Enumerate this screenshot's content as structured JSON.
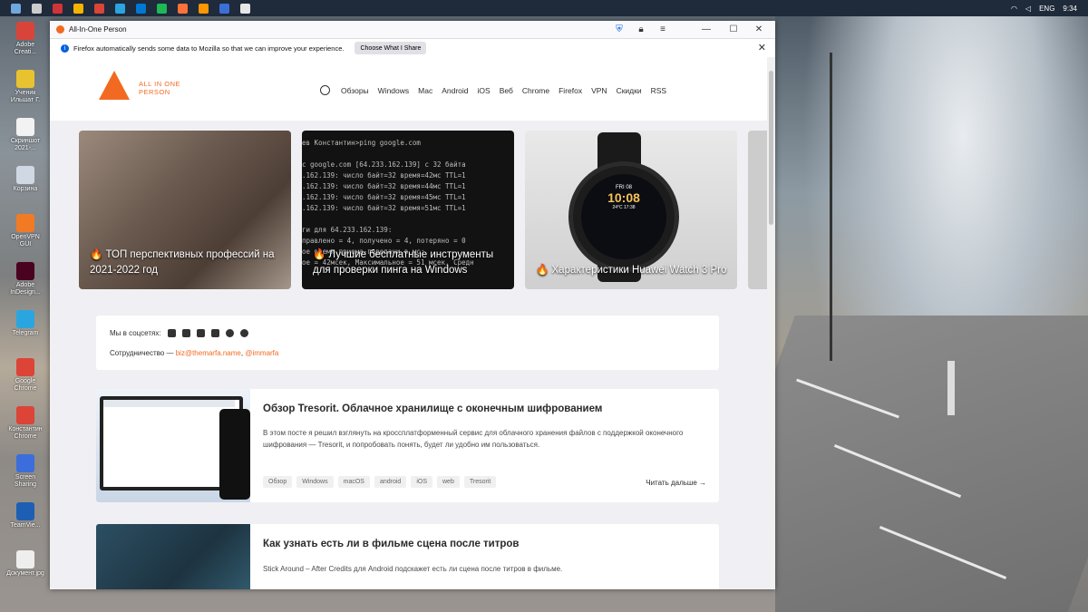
{
  "taskbar": {
    "icons": [
      {
        "name": "windows-start-icon",
        "color": "#6fa8dc"
      },
      {
        "name": "search-icon",
        "color": "#cccccc"
      },
      {
        "name": "app-red-icon",
        "color": "#d13438"
      },
      {
        "name": "chrome-icon",
        "color": "#f4b400"
      },
      {
        "name": "chrome-icon",
        "color": "#db4437"
      },
      {
        "name": "telegram-icon",
        "color": "#2aa5e0"
      },
      {
        "name": "outlook-icon",
        "color": "#0078d4"
      },
      {
        "name": "spotify-icon",
        "color": "#1db954"
      },
      {
        "name": "firefox-icon",
        "color": "#ff7139"
      },
      {
        "name": "firefox-icon",
        "color": "#ff9500"
      },
      {
        "name": "app-blue-icon",
        "color": "#3a6fd8"
      },
      {
        "name": "app-white-icon",
        "color": "#e6e6e6"
      }
    ],
    "tray": {
      "lang": "ENG",
      "time": "9:34"
    }
  },
  "desktop_icons": [
    {
      "label": "Adobe Creati...",
      "color": "#d9443a"
    },
    {
      "label": "Ученик Ильшат Г.",
      "color": "#e8c32f"
    },
    {
      "label": "Скриншот 2021-...",
      "color": "#f2f2f2"
    },
    {
      "label": "Корзина",
      "color": "#cfd8e3"
    },
    {
      "label": "OpenVPN GUI",
      "color": "#f17b24"
    },
    {
      "label": "Adobe InDesign...",
      "color": "#49021f"
    },
    {
      "label": "Telegram",
      "color": "#2aa5e0"
    },
    {
      "label": "Google Chrome",
      "color": "#db4437"
    },
    {
      "label": "Константин Chrome",
      "color": "#db4437"
    },
    {
      "label": "Screen Sharing",
      "color": "#3c6edb"
    },
    {
      "label": "TeamVie...",
      "color": "#1e5fb4"
    },
    {
      "label": "Документ.jpg",
      "color": "#eeeeee"
    }
  ],
  "window": {
    "title": "All-In-One Person",
    "notification": "Firefox automatically sends some data to Mozilla so that we can improve your experience.",
    "notification_button": "Choose What I Share"
  },
  "site": {
    "logo_text": "ALL IN ONE PERSON",
    "nav": [
      "Обзоры",
      "Windows",
      "Mac",
      "Android",
      "iOS",
      "Веб",
      "Chrome",
      "Firefox",
      "VPN",
      "Скидки",
      "RSS"
    ],
    "carousel": [
      {
        "title": "🔥 ТОП перспективных профессий на 2021-2022 год"
      },
      {
        "title": "🔥 Лучшие бесплатные инструменты для проверки пинга на Windows"
      },
      {
        "title": "🔥 Характеристики Huawei Watch 3 Pro"
      }
    ],
    "terminal_lines": [
      "ев Константин>ping google.com",
      "",
      "с google.com [64.233.162.139] с 32 байта",
      ".162.139: число байт=32 время=42мс TTL=1",
      ".162.139: число байт=32 время=44мс TTL=1",
      ".162.139: число байт=32 время=45мс TTL=1",
      ".162.139: число байт=32 время=51мс TTL=1",
      "",
      "ги для 64.233.162.139:",
      "правлено = 4, получено = 4, потеряно = 0",
      "ое время приема-передачи в мс:",
      "ое = 42мсек, Максимальное = 51 мсек, Средн"
    ],
    "watch": {
      "date": "FRI 08",
      "time": "10:08",
      "temp": "24°C 17:38"
    },
    "social_label": "Мы в соцсетях:",
    "coop_label": "Сотрудничество —",
    "coop_email": "biz@themarfa.name",
    "coop_sep": ",",
    "coop_handle": "@immarfa",
    "posts": [
      {
        "title": "Обзор Tresorit. Облачное хранилище с оконечным шифрованием",
        "excerpt": "В этом посте я решил взглянуть на кроссплатформенный сервис для облачного хранения файлов с поддержкой оконечного шифрования — Tresorit, и попробовать понять, будет ли удобно им пользоваться.",
        "tags": [
          "Обзор",
          "Windows",
          "macOS",
          "android",
          "iOS",
          "web",
          "Tresorit"
        ],
        "more": "Читать дальше →"
      },
      {
        "title": "Как узнать есть ли в фильме сцена после титров",
        "excerpt": "Stick Around – After Credits для Android подскажет есть ли сцена после титров в фильме."
      }
    ]
  },
  "colors": {
    "accent": "#f26a21",
    "taskbar": "#1f2a3a"
  }
}
